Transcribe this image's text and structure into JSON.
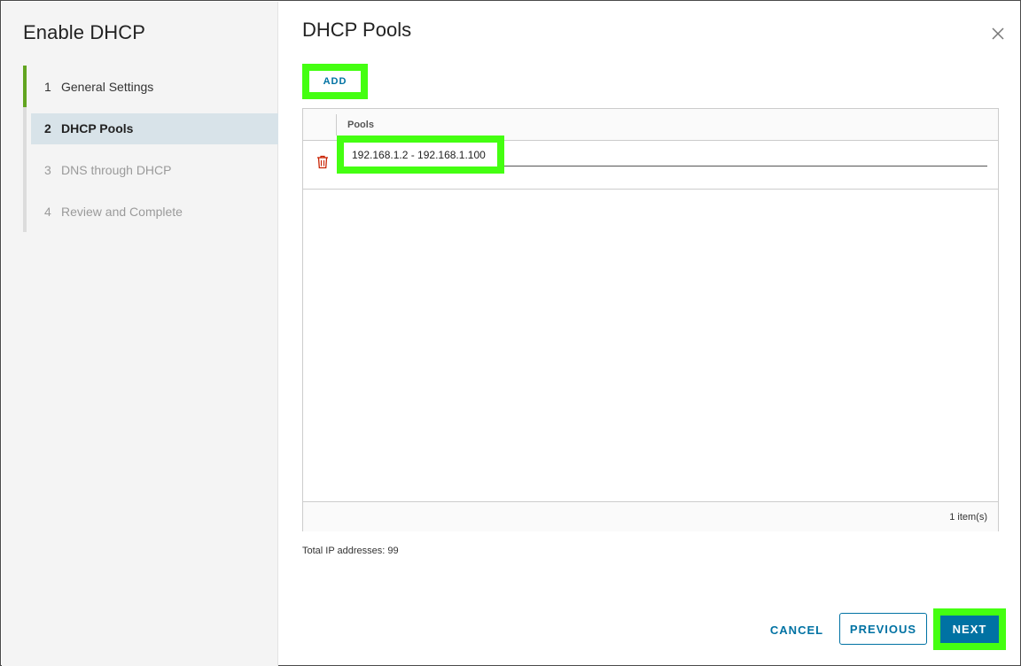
{
  "wizard": {
    "title": "Enable DHCP",
    "steps": [
      {
        "num": "1",
        "label": "General Settings",
        "state": "done"
      },
      {
        "num": "2",
        "label": "DHCP Pools",
        "state": "current"
      },
      {
        "num": "3",
        "label": "DNS through DHCP",
        "state": "disabled"
      },
      {
        "num": "4",
        "label": "Review and Complete",
        "state": "disabled"
      }
    ]
  },
  "main": {
    "title": "DHCP Pools",
    "close_icon": "close-icon",
    "add_label": "ADD",
    "grid": {
      "column_header": "Pools",
      "rows": [
        {
          "pool": "192.168.1.2 - 192.168.1.100",
          "delete_icon": "trash-icon"
        }
      ],
      "footer_count": "1 item(s)"
    },
    "total_ip": "Total IP addresses: 99"
  },
  "footer": {
    "cancel_label": "CANCEL",
    "previous_label": "PREVIOUS",
    "next_label": "NEXT"
  },
  "colors": {
    "accent": "#0072a3",
    "step_done": "#62a420",
    "current_step_bg": "#d8e3e9",
    "highlight": "#44ff11",
    "delete_icon": "#c92100"
  }
}
